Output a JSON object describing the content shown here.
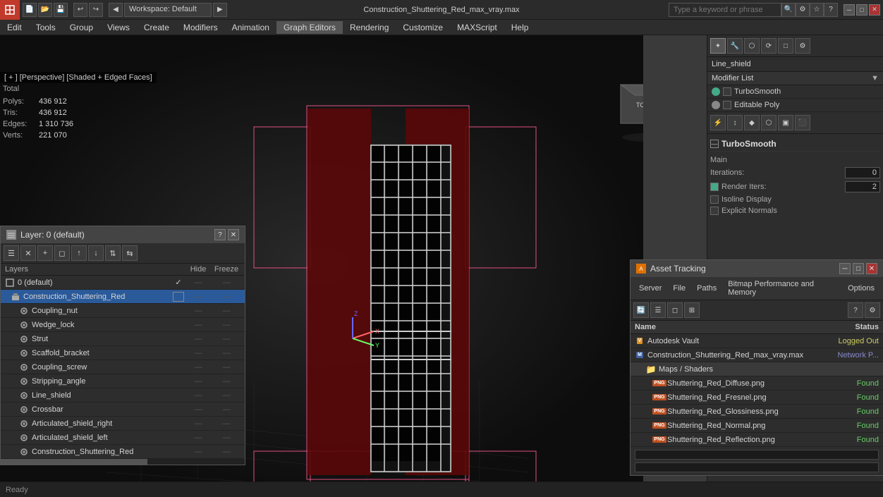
{
  "window": {
    "title": "Construction_Shuttering_Red_max_vray.max",
    "workspace": "Workspace: Default"
  },
  "topbar": {
    "app_initial": "3",
    "search_placeholder": "Type a keyword or phrase",
    "minimize": "─",
    "maximize": "□",
    "close": "✕"
  },
  "menu": {
    "items": [
      "Edit",
      "Tools",
      "Group",
      "Views",
      "Create",
      "Modifiers",
      "Animation",
      "Graph Editors",
      "Rendering",
      "Customize",
      "MAXScript",
      "Help"
    ]
  },
  "viewport": {
    "label": "[ + ] [Perspective] [Shaded + Edged Faces]"
  },
  "stats": {
    "polys_label": "Polys:",
    "polys_value": "436 912",
    "tris_label": "Tris:",
    "tris_value": "436 912",
    "edges_label": "Edges:",
    "edges_value": "1 310 736",
    "verts_label": "Verts:",
    "verts_value": "221 070",
    "total_label": "Total"
  },
  "right_panel": {
    "modifier_title": "Line_shield",
    "modifier_list_label": "Modifier List",
    "modifiers": [
      {
        "name": "TurboSmooth",
        "light": "green"
      },
      {
        "name": "Editable Poly",
        "light": "normal"
      }
    ],
    "turbosmooth": {
      "title": "TurboSmooth",
      "main_label": "Main",
      "iterations_label": "Iterations:",
      "iterations_value": "0",
      "render_iters_label": "Render Iters:",
      "render_iters_value": "2",
      "isoline_label": "Isoline Display",
      "explicit_label": "Explicit Normals"
    }
  },
  "layer_window": {
    "title": "Layer: 0 (default)",
    "columns": {
      "name": "Layers",
      "hide": "Hide",
      "freeze": "Freeze"
    },
    "items": [
      {
        "name": "0 (default)",
        "level": 0,
        "active": true,
        "type": "layer"
      },
      {
        "name": "Construction_Shuttering_Red",
        "level": 1,
        "selected": true,
        "type": "object"
      },
      {
        "name": "Coupling_nut",
        "level": 2,
        "type": "child"
      },
      {
        "name": "Wedge_lock",
        "level": 2,
        "type": "child"
      },
      {
        "name": "Strut",
        "level": 2,
        "type": "child"
      },
      {
        "name": "Scaffold_bracket",
        "level": 2,
        "type": "child"
      },
      {
        "name": "Coupling_screw",
        "level": 2,
        "type": "child"
      },
      {
        "name": "Stripping_angle",
        "level": 2,
        "type": "child"
      },
      {
        "name": "Line_shield",
        "level": 2,
        "type": "child"
      },
      {
        "name": "Crossbar",
        "level": 2,
        "type": "child"
      },
      {
        "name": "Articulated_shield_right",
        "level": 2,
        "type": "child"
      },
      {
        "name": "Articulated_shield_left",
        "level": 2,
        "type": "child"
      },
      {
        "name": "Construction_Shuttering_Red",
        "level": 2,
        "type": "child"
      }
    ]
  },
  "asset_tracking": {
    "title": "Asset Tracking",
    "menus": [
      "Server",
      "File",
      "Paths",
      "Bitmap Performance and Memory",
      "Options"
    ],
    "columns": {
      "name": "Name",
      "status": "Status"
    },
    "items": [
      {
        "name": "Autodesk Vault",
        "status": "Logged Out",
        "type": "vault",
        "level": 0
      },
      {
        "name": "Construction_Shuttering_Red_max_vray.max",
        "status": "Network P...",
        "type": "max",
        "level": 0
      },
      {
        "name": "Maps / Shaders",
        "status": "",
        "type": "folder",
        "level": 1
      },
      {
        "name": "Shuttering_Red_Diffuse.png",
        "status": "Found",
        "type": "png",
        "level": 2
      },
      {
        "name": "Shuttering_Red_Fresnel.png",
        "status": "Found",
        "type": "png",
        "level": 2
      },
      {
        "name": "Shuttering_Red_Glossiness.png",
        "status": "Found",
        "type": "png",
        "level": 2
      },
      {
        "name": "Shuttering_Red_Normal.png",
        "status": "Found",
        "type": "png",
        "level": 2
      },
      {
        "name": "Shuttering_Red_Reflection.png",
        "status": "Found",
        "type": "png",
        "level": 2
      }
    ]
  },
  "highlighted_items": {
    "coupling_in_layers": "Coupling",
    "scaffold_bracket": "Scaffold bracket",
    "coupling_screw": "Coupling"
  }
}
